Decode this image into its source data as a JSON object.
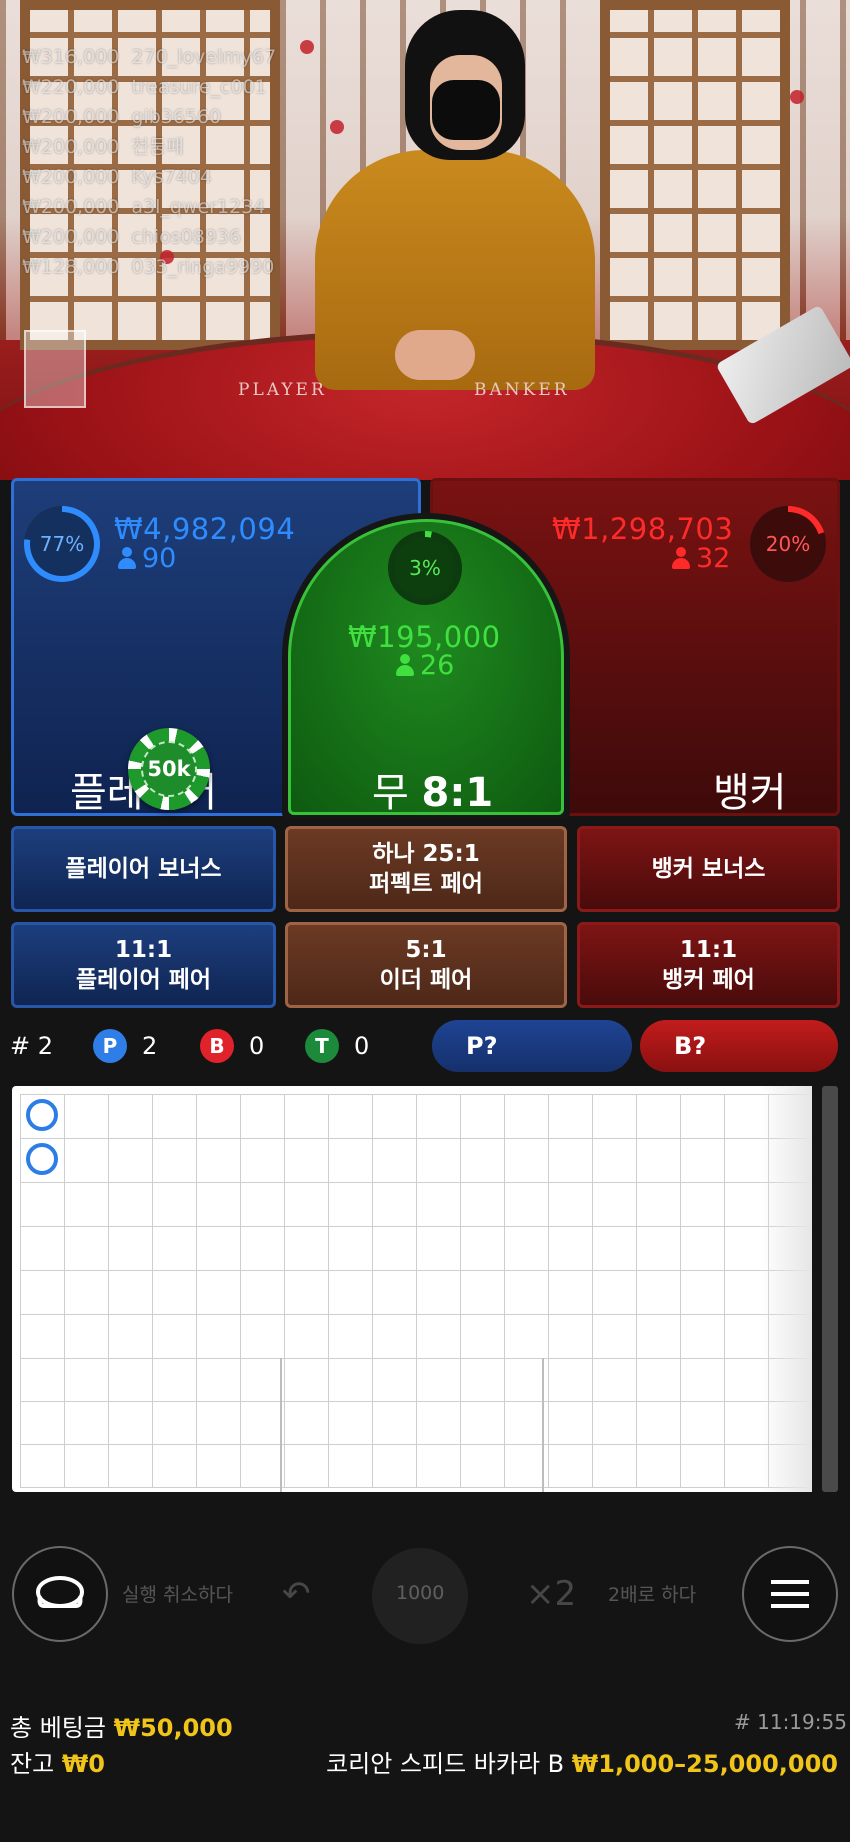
{
  "recent_winners": [
    {
      "amount": "₩316,000",
      "user": "270_lovelmy67"
    },
    {
      "amount": "₩220,000",
      "user": "treasure_c001"
    },
    {
      "amount": "₩200,000",
      "user": "gib36560"
    },
    {
      "amount": "₩200,000",
      "user": "천둥패"
    },
    {
      "amount": "₩200,000",
      "user": "Kys7404"
    },
    {
      "amount": "₩200,000",
      "user": "a3l_qwer1234"
    },
    {
      "amount": "₩200,000",
      "user": "chios08936"
    },
    {
      "amount": "₩128,000",
      "user": "033_ringa9990"
    }
  ],
  "table_labels": {
    "player": "PLAYER",
    "banker": "BANKER"
  },
  "player": {
    "percent": "77%",
    "amount": "₩4,982,094",
    "bettors": "90",
    "title": "플레이어"
  },
  "tie": {
    "percent": "3%",
    "amount": "₩195,000",
    "bettors": "26",
    "title": "무",
    "odds": "8:1"
  },
  "banker": {
    "percent": "20%",
    "amount": "₩1,298,703",
    "bettors": "32",
    "title": "뱅커"
  },
  "chip": {
    "label": "50k"
  },
  "side_bets": {
    "player_bonus": "플레이어 보너스",
    "perfect_pair_odds": "하나 25:1",
    "perfect_pair": "퍼펙트 페어",
    "banker_bonus": "뱅커 보너스",
    "player_pair_odds": "11:1",
    "player_pair": "플레이어 페어",
    "either_pair_odds": "5:1",
    "either_pair": "이더 페어",
    "banker_pair_odds": "11:1",
    "banker_pair": "뱅커 페어"
  },
  "stats": {
    "round": "# 2",
    "player_letter": "P",
    "player_count": "2",
    "banker_letter": "B",
    "banker_count": "0",
    "tie_letter": "T",
    "tie_count": "0",
    "player_predict": "P?",
    "banker_predict": "B?"
  },
  "controls": {
    "undo": "실행 취소하다",
    "chip_value": "1000",
    "double_symbol": "×2",
    "double": "2배로 하다"
  },
  "footer": {
    "total_bet_label": "총 베팅금",
    "total_bet": "₩50,000",
    "balance_label": "잔고",
    "balance": "₩0",
    "game_id": "# 11:19:55",
    "table_name": "코리안 스피드 바카라 B",
    "limits": "₩1,000–25,000,000"
  },
  "colors": {
    "player": "#2f8cff",
    "banker": "#ff2a2a",
    "tie": "#3fe03f",
    "gold": "#f0c419"
  }
}
